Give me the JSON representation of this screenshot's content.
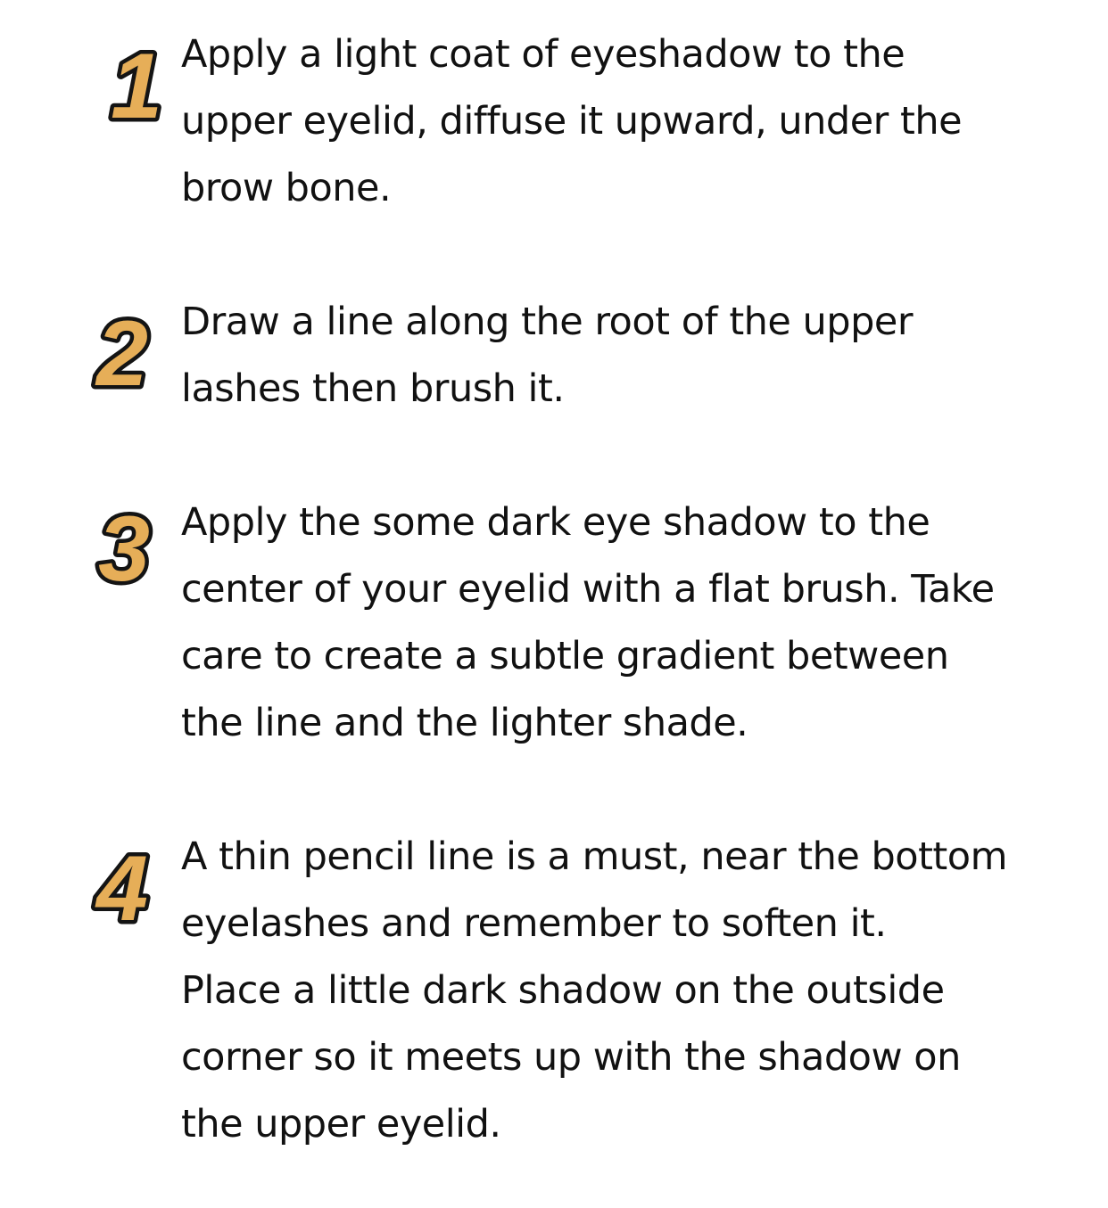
{
  "colors": {
    "number_fill": "#E6AE58",
    "number_outline": "#141414",
    "text": "#111111",
    "background": "#FFFFFF"
  },
  "steps": [
    {
      "number": "1",
      "text": "Apply a light coat of eyeshadow to the\nupper eyelid, diffuse it upward, under the\nbrow bone."
    },
    {
      "number": "2",
      "text": "Draw a line along the root of the upper\nlashes then brush it."
    },
    {
      "number": "3",
      "text": "Apply the some dark eye shadow to the\ncenter of your eyelid with a flat brush. Take\ncare to create a subtle gradient between\nthe line and the lighter shade."
    },
    {
      "number": "4",
      "text": "A thin pencil line is a must, near the bottom\neyelashes and remember to soften it.\nPlace a little dark shadow on the outside\ncorner so it meets up with the shadow on\nthe upper eyelid."
    }
  ]
}
